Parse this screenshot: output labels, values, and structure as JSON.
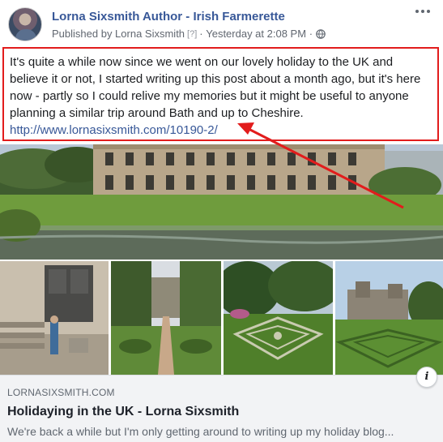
{
  "header": {
    "page_name": "Lorna Sixsmith Author - Irish Farmerette",
    "published_by": "Published by Lorna Sixsmith",
    "help_mark": "[?]",
    "separator": "·",
    "timestamp": "Yesterday at 2:08 PM",
    "separator2": "·",
    "privacy_icon": "globe-icon",
    "more_icon": "ellipsis-icon"
  },
  "post": {
    "text": "It's quite a while now since we went on our lovely holiday to the UK and believe it or not, I started writing up this post about a month ago, but it's here now - partly so I could relive my memories but it might be useful to anyone planning a similar trip around Bath and up to Cheshire.",
    "link": "http://www.lornasixsmith.com/10190-2/",
    "highlight_color": "#e21c1c"
  },
  "link_card": {
    "domain": "LORNASIXSMITH.COM",
    "title": "Holidaying in the UK - Lorna Sixsmith",
    "description": "We're back a while but I'm only getting around to writing up my holiday blog...",
    "info_icon": "i"
  },
  "colors": {
    "link_blue": "#385898",
    "annotation_red": "#e21c1c",
    "card_bg": "#f2f3f5"
  }
}
